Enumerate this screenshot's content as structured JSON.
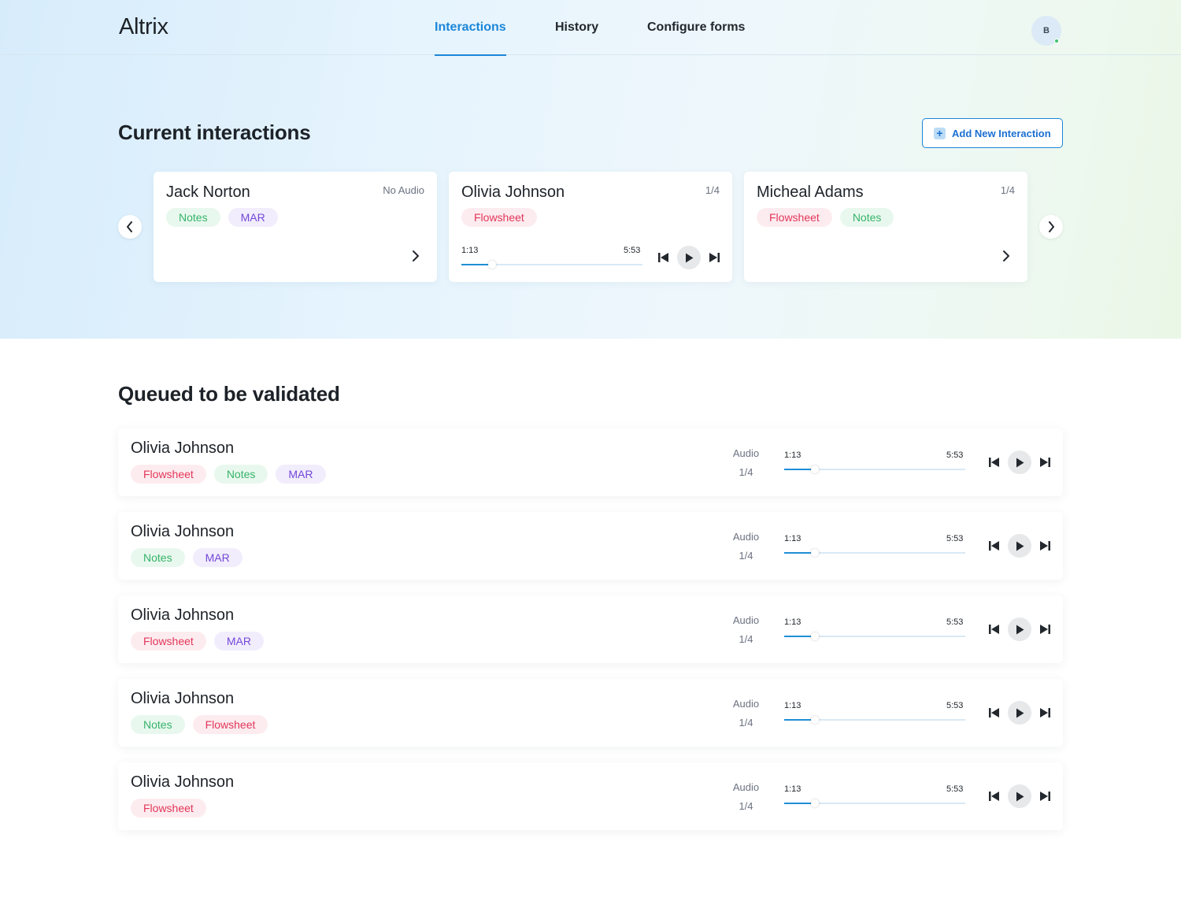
{
  "app": {
    "logo": "Altrix",
    "user_initial": "B"
  },
  "nav": {
    "interactions": "Interactions",
    "history": "History",
    "configure_forms": "Configure forms"
  },
  "current": {
    "title": "Current interactions",
    "add_button": "Add New Interaction",
    "cards": [
      {
        "name": "Jack Norton",
        "meta": "No Audio",
        "tags": [
          "Notes",
          "MAR"
        ]
      },
      {
        "name": "Olivia Johnson",
        "meta": "1/4",
        "tags": [
          "Flowsheet"
        ],
        "player": {
          "current": "1:13",
          "total": "5:53",
          "progress": 0.17
        }
      },
      {
        "name": "Micheal Adams",
        "meta": "1/4",
        "tags": [
          "Flowsheet",
          "Notes"
        ]
      }
    ]
  },
  "queue": {
    "title": "Queued to be validated",
    "rows": [
      {
        "name": "Olivia Johnson",
        "tags": [
          "Flowsheet",
          "Notes",
          "MAR"
        ],
        "audio_label": "Audio",
        "audio_count": "1/4",
        "current": "1:13",
        "total": "5:53",
        "progress": 0.17
      },
      {
        "name": "Olivia Johnson",
        "tags": [
          "Notes",
          "MAR"
        ],
        "audio_label": "Audio",
        "audio_count": "1/4",
        "current": "1:13",
        "total": "5:53",
        "progress": 0.17
      },
      {
        "name": "Olivia Johnson",
        "tags": [
          "Flowsheet",
          "MAR"
        ],
        "audio_label": "Audio",
        "audio_count": "1/4",
        "current": "1:13",
        "total": "5:53",
        "progress": 0.17
      },
      {
        "name": "Olivia Johnson",
        "tags": [
          "Notes",
          "Flowsheet"
        ],
        "audio_label": "Audio",
        "audio_count": "1/4",
        "current": "1:13",
        "total": "5:53",
        "progress": 0.17
      },
      {
        "name": "Olivia Johnson",
        "tags": [
          "Flowsheet"
        ],
        "audio_label": "Audio",
        "audio_count": "1/4",
        "current": "1:13",
        "total": "5:53",
        "progress": 0.17
      }
    ]
  },
  "colors": {
    "accent": "#1b86d8",
    "notes": "#35b46a",
    "mar": "#7446d8",
    "flowsheet": "#e2365a"
  }
}
